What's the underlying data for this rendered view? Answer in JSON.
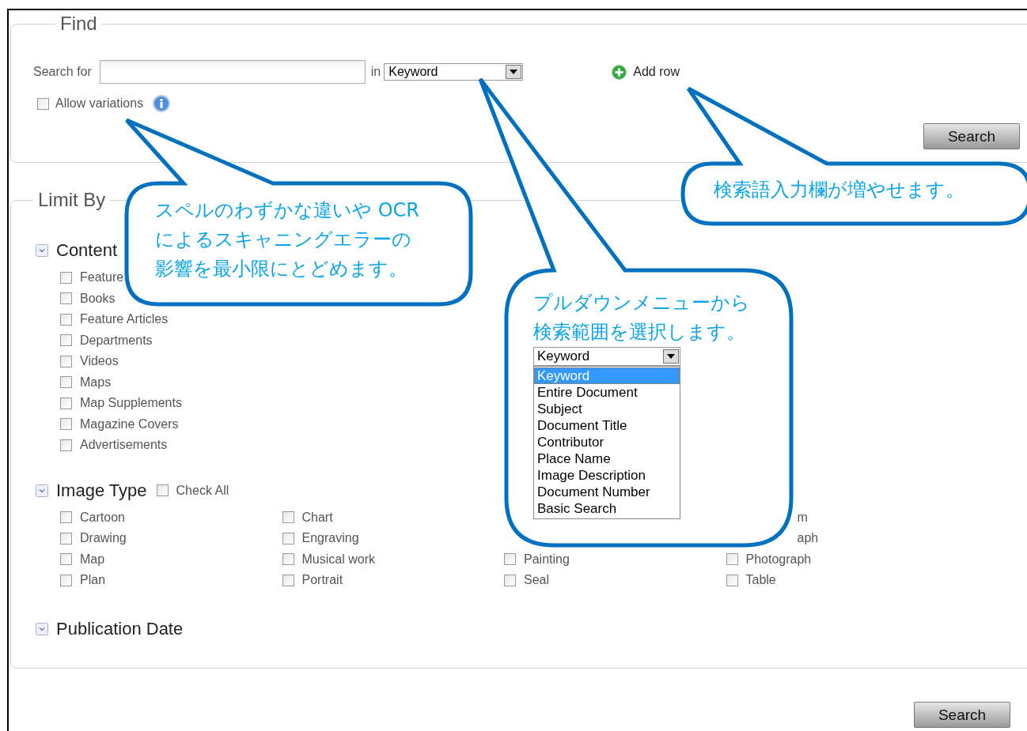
{
  "find": {
    "legend": "Find",
    "search_label": "Search for",
    "in_label": "in",
    "scope_select": {
      "value": "Keyword"
    },
    "add_row": "Add row",
    "allow_variations": {
      "label": "Allow variations",
      "checked": false
    },
    "search_button": "Search"
  },
  "limit_by": {
    "legend": "Limit By",
    "sections": [
      {
        "kind": "list",
        "title": "Content",
        "items": [
          {
            "label": "Feature",
            "checked": false
          },
          {
            "label": "Books",
            "checked": false
          },
          {
            "label": "Feature Articles",
            "checked": false
          },
          {
            "label": "Departments",
            "checked": false
          },
          {
            "label": "Videos",
            "checked": false
          },
          {
            "label": "Maps",
            "checked": false
          },
          {
            "label": "Map Supplements",
            "checked": false
          },
          {
            "label": "Magazine Covers",
            "checked": false
          },
          {
            "label": "Advertisements",
            "checked": false
          }
        ]
      },
      {
        "kind": "grid",
        "title": "Image Type",
        "check_all": {
          "label": "Check All",
          "checked": false
        },
        "columns": [
          [
            {
              "label": "Cartoon",
              "checked": false
            },
            {
              "label": "Drawing",
              "checked": false
            },
            {
              "label": "Map",
              "checked": false
            },
            {
              "label": "Plan",
              "checked": false
            }
          ],
          [
            {
              "label": "Chart",
              "checked": false
            },
            {
              "label": "Engraving",
              "checked": false
            },
            {
              "label": "Musical work",
              "checked": false
            },
            {
              "label": "Portrait",
              "checked": false
            }
          ],
          [
            {
              "label": "Painting",
              "checked": false
            },
            {
              "label": "Seal",
              "checked": false
            }
          ],
          [
            {
              "label": "m",
              "clipped": true
            },
            {
              "label": "aph",
              "clipped": true
            },
            {
              "label": "Photograph",
              "checked": false
            },
            {
              "label": "Table",
              "checked": false
            }
          ]
        ]
      },
      {
        "kind": "header",
        "title": "Publication Date"
      }
    ]
  },
  "bottom_search_button": "Search",
  "callouts": [
    {
      "text": "スペルのわずかな違いや OCRによるスキャニングエラーの影響を最小限にとどめます。"
    },
    {
      "text": "検索語入力欄が増やせます。"
    },
    {
      "text": "プルダウンメニューから検索範囲を選択します。",
      "dropdown": {
        "value": "Keyword",
        "options": [
          {
            "label": "Keyword",
            "selected": true
          },
          {
            "label": "Entire Document",
            "selected": false
          },
          {
            "label": "Subject",
            "selected": false
          },
          {
            "label": "Document Title",
            "selected": false
          },
          {
            "label": "Contributor",
            "selected": false
          },
          {
            "label": "Place Name",
            "selected": false
          },
          {
            "label": "Image Description",
            "selected": false
          },
          {
            "label": "Document Number",
            "selected": false
          },
          {
            "label": "Basic Search",
            "selected": false
          }
        ]
      }
    }
  ]
}
